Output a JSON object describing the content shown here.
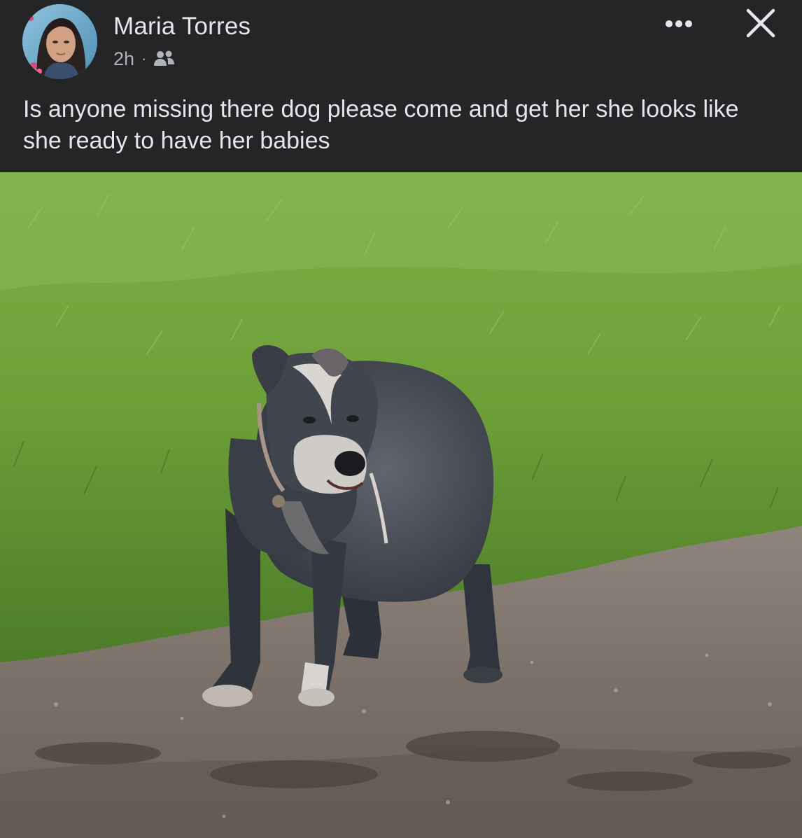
{
  "post": {
    "author": "Maria Torres",
    "timestamp": "2h",
    "separator": "·",
    "audience_icon": "friends-icon",
    "text": "Is anyone missing there dog please come and get her she looks like she ready to have her babies",
    "more_icon": "more-options-icon",
    "close_icon": "close-icon"
  },
  "colors": {
    "background": "#242526",
    "primary_text": "#e4e6eb",
    "secondary_text": "#b0b3b8"
  }
}
